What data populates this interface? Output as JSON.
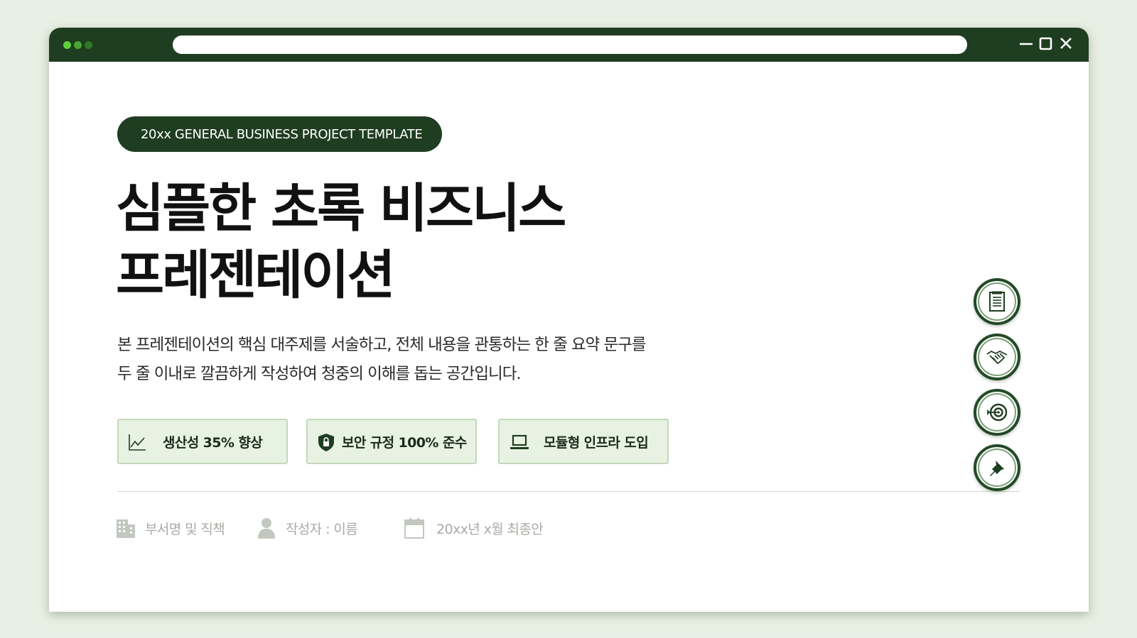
{
  "colors": {
    "primary": "#1f3d20",
    "badge_bg": "#e8f2e2",
    "badge_border": "#c4d8bc",
    "meta_text": "#a6aca4",
    "dot_1": "#5fd13e",
    "dot_2": "#46a831",
    "dot_3": "#2f7a25"
  },
  "window": {
    "controls": [
      "minimize-icon",
      "maximize-icon",
      "close-icon"
    ]
  },
  "header": {
    "tag": "20xx GENERAL BUSINESS PROJECT TEMPLATE",
    "title_line1": "심플한 초록 비즈니스",
    "title_line2": "프레젠테이션"
  },
  "description": {
    "line1": "본 프레젠테이션의 핵심 대주제를 서술하고, 전체 내용을 관통하는 한 줄 요약 문구를",
    "line2": "두 줄 이내로 깔끔하게 작성하여 청중의 이해를 돕는 공간입니다."
  },
  "badges": [
    {
      "icon": "line-chart-icon",
      "label": "생산성 35% 향상"
    },
    {
      "icon": "shield-lock-icon",
      "label": "보안 규정 100% 준수"
    },
    {
      "icon": "laptop-icon",
      "label": "모듈형 인프라 도입"
    }
  ],
  "meta": [
    {
      "icon": "building-icon",
      "label": "부서명 및 직책"
    },
    {
      "icon": "person-icon",
      "label": "작성자 : 이름"
    },
    {
      "icon": "calendar-icon",
      "label": "20xx년 x월 최종안"
    }
  ],
  "side_icons": [
    "document-icon",
    "handshake-icon",
    "target-icon",
    "pin-icon"
  ]
}
